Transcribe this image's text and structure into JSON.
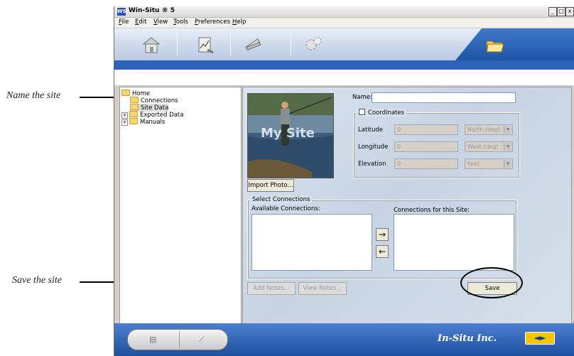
{
  "annotations": {
    "name_site": "Name the site",
    "save_site": "Save the site"
  },
  "window": {
    "title": "Win-Situ ® 5",
    "app_icon_text": "WS",
    "controls": [
      "_",
      "□",
      "x"
    ]
  },
  "menu": [
    "File",
    "Edit",
    "View",
    "Tools",
    "Preferences",
    "Help"
  ],
  "toolbar": {
    "icons": [
      "home-icon",
      "data-icon",
      "tools-icon",
      "gear-icon",
      "folder-icon"
    ]
  },
  "tree": {
    "home": "Home",
    "connections": "Connections",
    "site_data": "Site Data",
    "exported_data": "Exported Data",
    "manuals": "Manuals"
  },
  "site_form": {
    "photo_overlay_text": "My Site",
    "import_photo": "Import Photo...",
    "name_label": "Name:",
    "name_value": "",
    "coordinates_label": "Coordinates",
    "latitude_label": "Latitude",
    "latitude_value": "0",
    "latitude_unit": "North (deg)",
    "longitude_label": "Longitude",
    "longitude_value": "0",
    "longitude_unit": "West (deg)",
    "elevation_label": "Elevation",
    "elevation_value": "0",
    "elevation_unit": "Feet"
  },
  "connections": {
    "group_title": "Select Connections",
    "available_label": "Available Connections:",
    "site_label": "Connections for this Site:",
    "add_arrow": "→",
    "remove_arrow": "←"
  },
  "buttons": {
    "add_notes": "Add Notes...",
    "view_notes": "View Notes...",
    "save": "Save"
  },
  "bottom": {
    "brand": "In-Situ Inc.",
    "logo_text": "◄►"
  }
}
